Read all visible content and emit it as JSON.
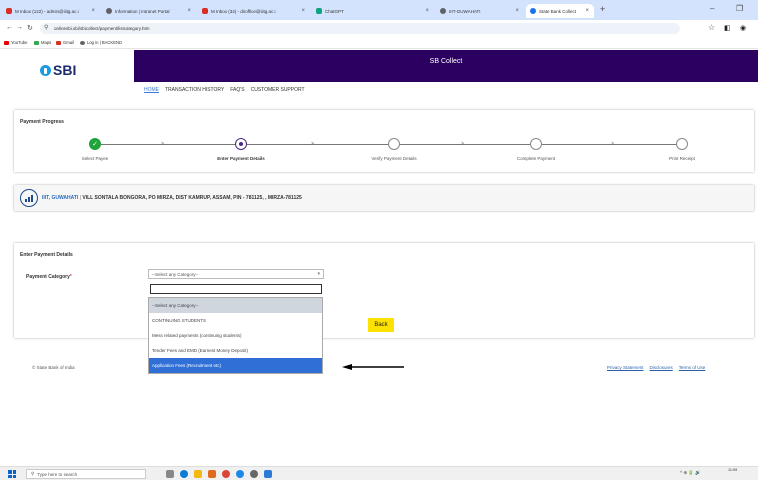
{
  "browser": {
    "tabs": [
      {
        "label": "M Inbox (122) - admin@iiitg.ac.i",
        "color": "#d93025",
        "active": false
      },
      {
        "label": "Information | Intranet Portal",
        "color": "#5f6368",
        "active": false
      },
      {
        "label": "M Inbox (34) - diroffice@iiitg.ac.i",
        "color": "#d93025",
        "active": false
      },
      {
        "label": "ChatGPT",
        "color": "#10a37f",
        "active": false
      },
      {
        "label": "IIIT-GUWAHATI",
        "color": "#5f6368",
        "active": false
      },
      {
        "label": "State Bank Collect",
        "color": "#1a73e8",
        "active": true
      }
    ],
    "new_tab": "+",
    "minimize": "–",
    "restore": "❐",
    "url": "onlinesbi.sbi/sbicollect/payment/listcategory.htm",
    "bookmarks": [
      {
        "label": "YouTube",
        "color": "#e00"
      },
      {
        "label": "Maps",
        "color": "#34a853"
      },
      {
        "label": "Gmail",
        "color": "#d93025"
      },
      {
        "label": "Log in | BACKEND",
        "color": "#5f6368"
      }
    ]
  },
  "sbi": {
    "logo": "SBI",
    "banner": "SB Collect",
    "nav": [
      "HOME",
      "TRANSACTION HISTORY",
      "FAQ'S",
      "CUSTOMER SUPPORT"
    ]
  },
  "progress": {
    "title": "Payment Progress",
    "steps": [
      "Select Payee",
      "Enter Payment Details",
      "Verify Payment Details",
      "Complete Payment",
      "Print Receipt"
    ]
  },
  "institute": {
    "name": "IIIT, GUWAHATI",
    "separator": "|",
    "address": "VILL SONTALA BONGORA, PO MIRZA, DIST KAMRUP, ASSAM, PIN - 781125, , MIRZA-781125"
  },
  "details": {
    "title": "Enter Payment Details",
    "category_label": "Payment Category",
    "required_mark": "*",
    "select_value": "--Select any Category--",
    "back_label": "Back",
    "options": [
      "--Select any Category--",
      "CONTINUING STUDENTS",
      "Mess related payments (continuing students)",
      "Tender Fees and EMD (Earnest Money Deposit)",
      "Application Fees (Recruitment etc)"
    ],
    "selected_index": 0,
    "highlighted_index": 4
  },
  "footer": {
    "copyright": "© State Bank of India",
    "links": [
      "Privacy Statement",
      "Disclosures",
      "Terms of Use"
    ]
  },
  "taskbar": {
    "search_placeholder": "Type here to search",
    "time": "11:59",
    "tray": "^ ⊕ 🔋 🔊"
  },
  "colors": {
    "sbi_purple": "#2b0060",
    "step_done": "#1fa43a",
    "back_button": "#fde100",
    "option_highlight": "#2f6fd6"
  }
}
